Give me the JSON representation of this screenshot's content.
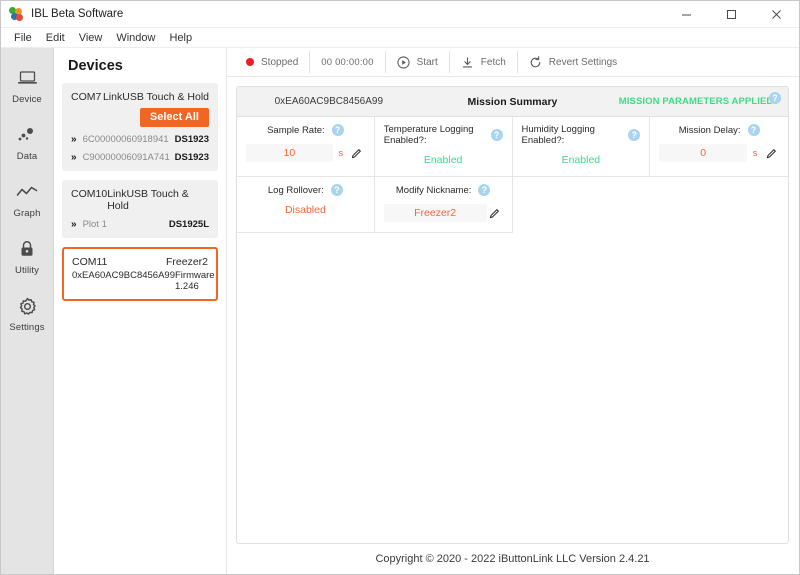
{
  "window": {
    "title": "IBL Beta Software",
    "app_icon": "ibuttonlink-logo-icon",
    "minimize_label": "–",
    "maximize_label": "☐",
    "close_label": "✕"
  },
  "menubar": {
    "items": [
      {
        "label": "File"
      },
      {
        "label": "Edit"
      },
      {
        "label": "View"
      },
      {
        "label": "Window"
      },
      {
        "label": "Help"
      }
    ]
  },
  "rail": {
    "items": [
      {
        "label": "Device",
        "icon": "laptop-icon"
      },
      {
        "label": "Data",
        "icon": "scatter-dots-icon"
      },
      {
        "label": "Graph",
        "icon": "line-chart-icon"
      },
      {
        "label": "Utility",
        "icon": "lock-icon"
      },
      {
        "label": "Settings",
        "icon": "gear-icon"
      }
    ]
  },
  "devices": {
    "header": "Devices",
    "select_all_label": "Select All",
    "cards": [
      {
        "port": "COM7",
        "type": "LinkUSB Touch & Hold",
        "has_select_all": true,
        "rows": [
          {
            "serial": "6C00000060918941",
            "model": "DS1923"
          },
          {
            "serial": "C90000006091A741",
            "model": "DS1923"
          }
        ]
      },
      {
        "port": "COM10",
        "type": "LinkUSB Touch & Hold",
        "has_select_all": false,
        "rows": [
          {
            "serial": "Plot 1",
            "model": "DS1925L"
          }
        ]
      }
    ],
    "selected_card": {
      "port": "COM11",
      "nickname": "Freezer2",
      "serial": "0xEA60AC9BC8456A99",
      "firmware": "Firmware 1.246"
    }
  },
  "toolbar": {
    "status_label": "Stopped",
    "status_color": "#ee1c25",
    "timer": "00 00:00:00",
    "start_label": "Start",
    "start_icon": "play-circle-icon",
    "fetch_label": "Fetch",
    "fetch_icon": "download-icon",
    "revert_label": "Revert Settings",
    "revert_icon": "refresh-icon"
  },
  "summary": {
    "device_id": "0xEA60AC9BC8456A99",
    "title": "Mission Summary",
    "status": "MISSION PARAMETERS APPLIED",
    "status_color": "#3ddc84",
    "help_label": "?",
    "edit_icon": "pencil-icon",
    "cells": [
      {
        "title": "Sample Rate:",
        "kind": "field",
        "value": "10",
        "unit": "s",
        "editable": true
      },
      {
        "title": "Temperature Logging Enabled?:",
        "kind": "text",
        "value": "Enabled",
        "value_style": "green"
      },
      {
        "title": "Humidity Logging Enabled?:",
        "kind": "text",
        "value": "Enabled",
        "value_style": "green"
      },
      {
        "title": "Mission Delay:",
        "kind": "field",
        "value": "0",
        "unit": "s",
        "editable": true
      },
      {
        "title": "Log Rollover:",
        "kind": "text",
        "value": "Disabled",
        "value_style": "orange"
      },
      {
        "title": "Modify Nickname:",
        "kind": "field",
        "value": "Freezer2",
        "unit": "",
        "editable": true
      }
    ]
  },
  "footer": {
    "copyright": "Copyright © 2020 - 2022 iButtonLink LLC Version 2.4.21"
  }
}
